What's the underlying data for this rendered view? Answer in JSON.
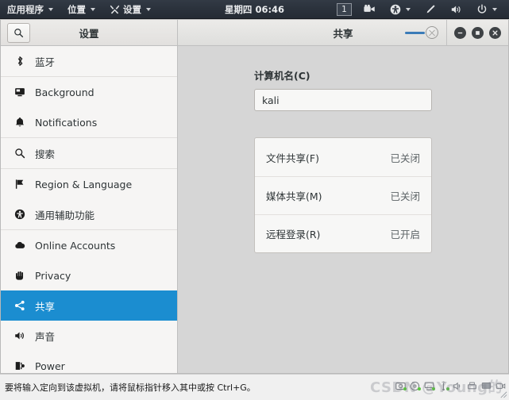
{
  "topbar": {
    "menus": [
      {
        "label": "应用程序",
        "icon": "",
        "caret": true
      },
      {
        "label": "位置",
        "icon": "",
        "caret": true
      },
      {
        "label": "设置",
        "icon": "tools-icon",
        "caret": true
      }
    ],
    "clock": "星期四 06:46",
    "workspace": "1",
    "right_icons": [
      "screencast-icon",
      "accessibility-icon",
      "accessibility-caret",
      "pen-icon",
      "volume-icon",
      "power-icon",
      "power-caret"
    ]
  },
  "sidebar": {
    "title": "设置",
    "search_icon": "search-icon",
    "items": [
      {
        "label": "蓝牙",
        "icon": "bluetooth-icon",
        "selected": false,
        "sep_after": true
      },
      {
        "label": "Background",
        "icon": "monitor-icon",
        "selected": false,
        "sep_after": false
      },
      {
        "label": "Notifications",
        "icon": "bell-icon",
        "selected": false,
        "sep_after": true
      },
      {
        "label": "搜索",
        "icon": "search-icon",
        "selected": false,
        "sep_after": true
      },
      {
        "label": "Region & Language",
        "icon": "flag-icon",
        "selected": false,
        "sep_after": false
      },
      {
        "label": "通用辅助功能",
        "icon": "accessibility-icon",
        "selected": false,
        "sep_after": true
      },
      {
        "label": "Online Accounts",
        "icon": "cloud-icon",
        "selected": false,
        "sep_after": false
      },
      {
        "label": "Privacy",
        "icon": "hand-icon",
        "selected": false,
        "sep_after": false
      },
      {
        "label": "共享",
        "icon": "share-icon",
        "selected": true,
        "sep_after": false
      },
      {
        "label": "声音",
        "icon": "volume-icon",
        "selected": false,
        "sep_after": false
      },
      {
        "label": "Power",
        "icon": "power-plug-icon",
        "selected": false,
        "sep_after": false
      }
    ]
  },
  "window": {
    "title": "共享",
    "master_switch_state": "on",
    "buttons": {
      "minimize": "minimize-button",
      "maximize": "maximize-button",
      "close": "close-button"
    }
  },
  "main": {
    "computer_name_label": "计算机名(C)",
    "computer_name_value": "kali",
    "computer_name_placeholder": "",
    "options": [
      {
        "label": "文件共享(F)",
        "state": "已关闭"
      },
      {
        "label": "媒体共享(M)",
        "state": "已关闭"
      },
      {
        "label": "远程登录(R)",
        "state": "已开启"
      }
    ]
  },
  "statusbar": {
    "message": "要将输入定向到该虚拟机，请将鼠标指针移入其中或按 Ctrl+G。",
    "watermark": "CSDN @Young的",
    "device_icons": [
      "hard-disk-icon",
      "cdrom-icon",
      "network-icon",
      "usb-icon",
      "sound-icon",
      "printer-icon",
      "display-icon",
      "camera-icon"
    ]
  },
  "colors": {
    "accent": "#1b8dd0",
    "topbar_bg": "#2b323c",
    "content_bg": "#d6d6d6",
    "sidebar_bg": "#f6f5f4",
    "status_on": "#3fbe20"
  }
}
